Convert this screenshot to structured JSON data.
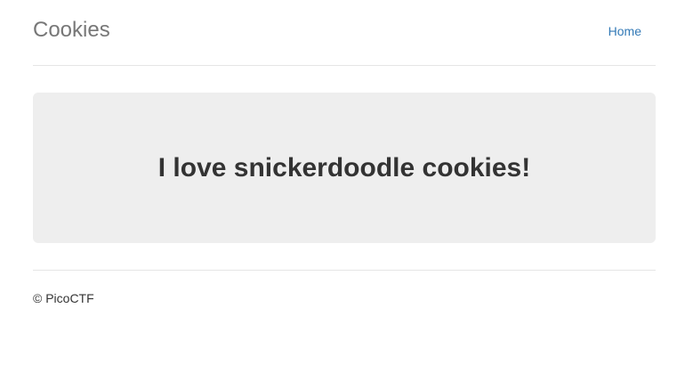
{
  "header": {
    "brand": "Cookies",
    "nav": [
      {
        "label": "Home"
      }
    ]
  },
  "main": {
    "headline": "I love snickerdoodle cookies!"
  },
  "footer": {
    "text": "© PicoCTF"
  }
}
